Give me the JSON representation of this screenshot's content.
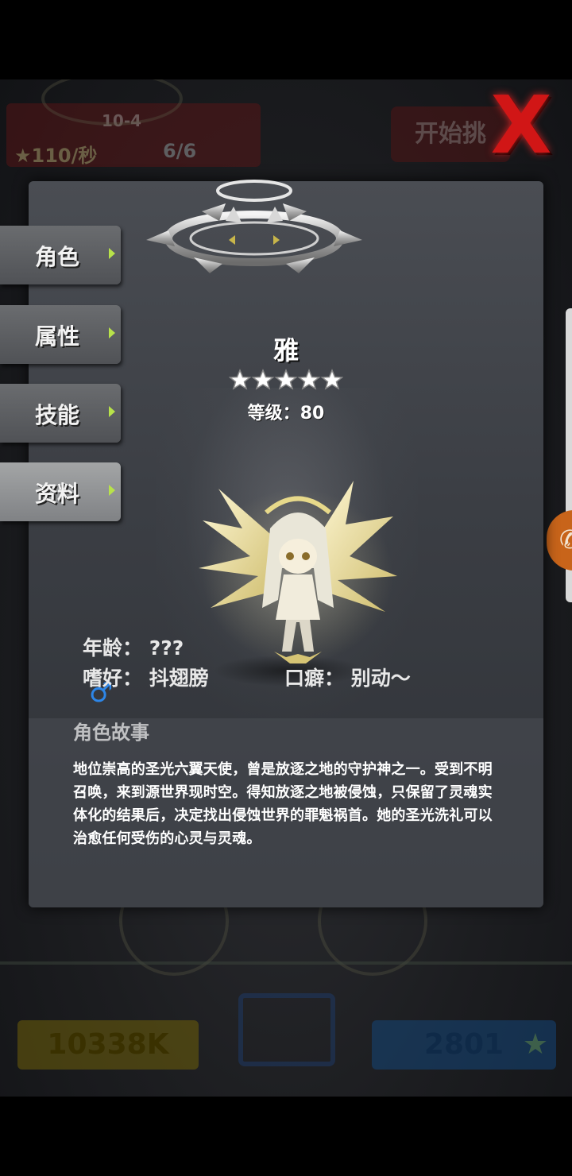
{
  "background_hud": {
    "stage": "10-4",
    "rate": "★110/秒",
    "team": "6/6",
    "start_button": "开始挑",
    "gold": "10338K",
    "gems": "2801"
  },
  "tabs": [
    {
      "label": "角色"
    },
    {
      "label": "属性"
    },
    {
      "label": "技能"
    },
    {
      "label": "资料"
    }
  ],
  "active_tab": "资料",
  "character": {
    "name": "雅",
    "stars": 5,
    "level_label": "等级：",
    "level_value": "80",
    "gender_symbol": "♂",
    "age_label": "年龄：",
    "age_value": "???",
    "hobby_label": "嗜好：",
    "hobby_value": "抖翅膀",
    "catchphrase_label": "口癖：",
    "catchphrase_value": "别动～"
  },
  "story": {
    "title": "角色故事",
    "text": "地位崇高的圣光六翼天使，曾是放逐之地的守护神之一。受到不明召唤，来到源世界现时空。得知放逐之地被侵蚀，只保留了灵魂实体化的结果后，决定找出侵蚀世界的罪魁祸首。她的圣光洗礼可以治愈任何受伤的心灵与灵魂。"
  },
  "colors": {
    "close": "#d11616",
    "tab_arrow": "#b8e24a",
    "gender": "#2d86e8",
    "active_tab": "#a3a5a6"
  },
  "icons": [
    "close-x-icon",
    "star-icon",
    "male-gender-icon",
    "tab-arrow-icon",
    "halo-emblem-icon"
  ]
}
